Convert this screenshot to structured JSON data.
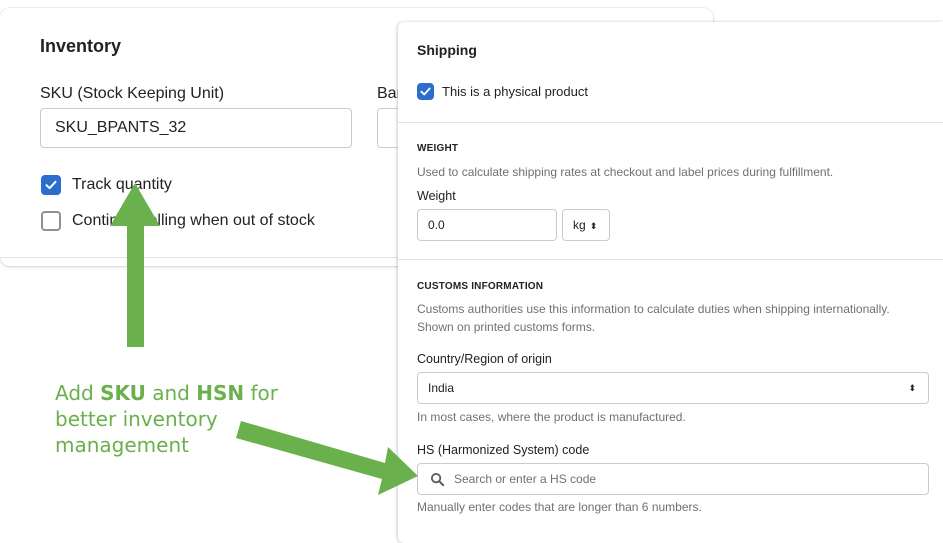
{
  "inventory": {
    "title": "Inventory",
    "sku_label": "SKU (Stock Keeping Unit)",
    "barcode_label_partial": "Bar",
    "sku_value": "SKU_BPANTS_32",
    "track_quantity_label": "Track quantity",
    "track_quantity_checked": true,
    "continue_selling_label": "Continue selling when out of stock",
    "continue_selling_checked": false
  },
  "shipping": {
    "title": "Shipping",
    "physical_product_label": "This is a physical product",
    "physical_product_checked": true,
    "weight": {
      "heading": "WEIGHT",
      "help": "Used to calculate shipping rates at checkout and label prices during fulfillment.",
      "label": "Weight",
      "value": "0.0",
      "unit": "kg"
    },
    "customs": {
      "heading": "CUSTOMS INFORMATION",
      "help_line1": "Customs authorities use this information to calculate duties when shipping internationally.",
      "help_line2": "Shown on printed customs forms.",
      "country_label": "Country/Region of origin",
      "country_value": "India",
      "country_help": "In most cases, where the product is manufactured.",
      "hs_label": "HS (Harmonized System) code",
      "hs_placeholder": "Search or enter a HS code",
      "hs_help": "Manually enter codes that are longer than 6 numbers."
    }
  },
  "annotation": {
    "part1": "Add ",
    "bold1": "SKU",
    "part2": " and ",
    "bold2": "HSN",
    "part3": " for",
    "line2": "better inventory",
    "line3": "management",
    "color": "#6ab04c"
  },
  "colors": {
    "checkbox_blue": "#2c6ecb",
    "border": "#c9cccf",
    "subdued_text": "#6d7175",
    "arrow_green": "#6ab04c"
  }
}
